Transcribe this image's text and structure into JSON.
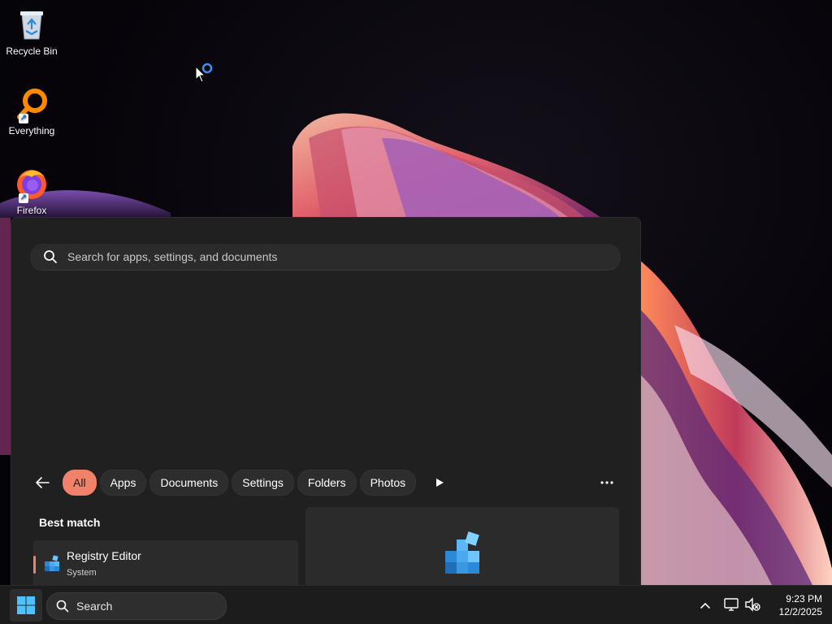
{
  "desktop": {
    "icons": [
      {
        "label": "Recycle Bin",
        "icon": "recycle-bin-icon"
      },
      {
        "label": "Everything",
        "icon": "everything-search-icon"
      },
      {
        "label": "Firefox",
        "icon": "firefox-icon"
      }
    ]
  },
  "search_panel": {
    "search_placeholder": "Search for apps, settings, and documents",
    "filters": [
      "All",
      "Apps",
      "Documents",
      "Settings",
      "Folders",
      "Photos"
    ],
    "active_filter": "All",
    "best_match_title": "Best match",
    "best_match": {
      "title": "Registry Editor",
      "subtitle": "System",
      "icon": "registry-editor-icon"
    }
  },
  "taskbar": {
    "search_label": "Search",
    "time": "9:23 PM",
    "date": "12/2/2025"
  },
  "colors": {
    "accent": "#f0826a",
    "panel_bg": "#202020",
    "taskbar_bg": "#1c1c1c"
  }
}
